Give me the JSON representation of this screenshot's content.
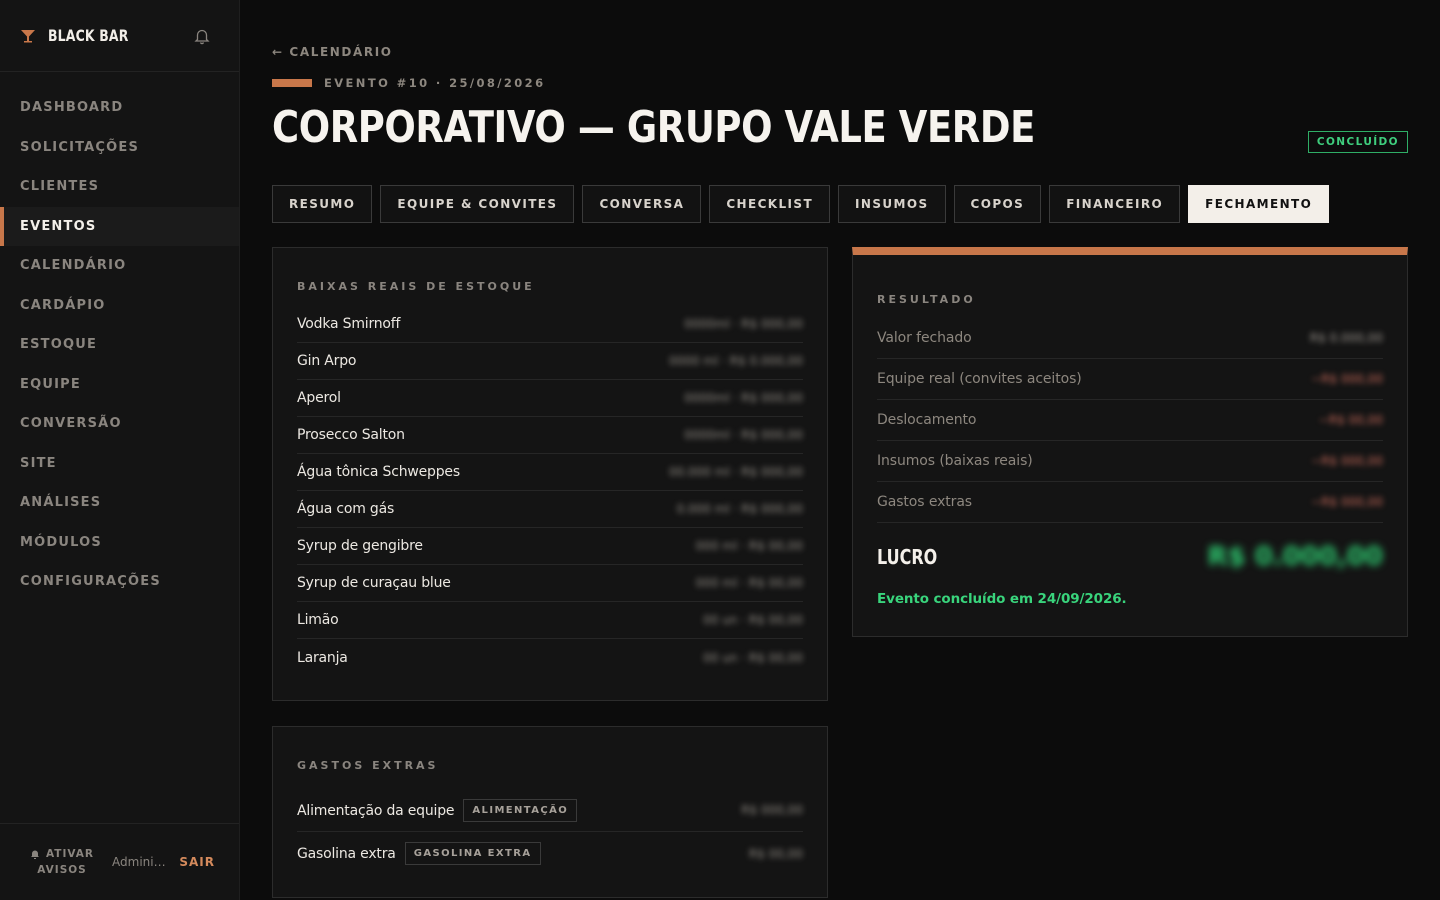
{
  "app": {
    "name": "BLACK BAR"
  },
  "sidebar": {
    "items": [
      {
        "label": "DASHBOARD",
        "active": false
      },
      {
        "label": "SOLICITAÇÕES",
        "active": false
      },
      {
        "label": "CLIENTES",
        "active": false
      },
      {
        "label": "EVENTOS",
        "active": true
      },
      {
        "label": "CALENDÁRIO",
        "active": false
      },
      {
        "label": "CARDÁPIO",
        "active": false
      },
      {
        "label": "ESTOQUE",
        "active": false
      },
      {
        "label": "EQUIPE",
        "active": false
      },
      {
        "label": "CONVERSÃO",
        "active": false
      },
      {
        "label": "SITE",
        "active": false
      },
      {
        "label": "ANÁLISES",
        "active": false
      },
      {
        "label": "MÓDULOS",
        "active": false
      },
      {
        "label": "CONFIGURAÇÕES",
        "active": false
      }
    ],
    "footer": {
      "notify_line1": "ATIVAR",
      "notify_line2": "AVISOS",
      "user": "Administ...",
      "logout": "SAIR"
    }
  },
  "header": {
    "back": "← CALENDÁRIO",
    "meta": "EVENTO #10 · 25/08/2026",
    "title": "CORPORATIVO — GRUPO VALE VERDE",
    "status": "CONCLUÍDO"
  },
  "tabs": [
    {
      "label": "RESUMO",
      "active": false
    },
    {
      "label": "EQUIPE & CONVITES",
      "active": false
    },
    {
      "label": "CONVERSA",
      "active": false
    },
    {
      "label": "CHECKLIST",
      "active": false
    },
    {
      "label": "INSUMOS",
      "active": false
    },
    {
      "label": "COPOS",
      "active": false
    },
    {
      "label": "FINANCEIRO",
      "active": false
    },
    {
      "label": "FECHAMENTO",
      "active": true
    }
  ],
  "stock": {
    "title": "BAIXAS REAIS DE ESTOQUE",
    "items": [
      {
        "name": "Vodka Smirnoff",
        "value": "0000ml · R$ 000,00"
      },
      {
        "name": "Gin Arpo",
        "value": "0000 ml · R$ 0.000,00"
      },
      {
        "name": "Aperol",
        "value": "0000ml · R$ 000,00"
      },
      {
        "name": "Prosecco Salton",
        "value": "0000ml · R$ 000,00"
      },
      {
        "name": "Água tônica Schweppes",
        "value": "00.000 ml · R$ 000,00"
      },
      {
        "name": "Água com gás",
        "value": "0.000 ml · R$ 000,00"
      },
      {
        "name": "Syrup de gengibre",
        "value": "000 ml · R$ 00,00"
      },
      {
        "name": "Syrup de curaçau blue",
        "value": "000 ml · R$ 00,00"
      },
      {
        "name": "Limão",
        "value": "00 un · R$ 00,00"
      },
      {
        "name": "Laranja",
        "value": "00 un · R$ 00,00"
      }
    ]
  },
  "extras": {
    "title": "GASTOS EXTRAS",
    "items": [
      {
        "name": "Alimentação da equipe",
        "tag": "ALIMENTAÇÃO",
        "value": "R$ 000,00"
      },
      {
        "name": "Gasolina extra",
        "tag": "GASOLINA EXTRA",
        "value": "R$ 00,00"
      }
    ]
  },
  "result": {
    "title": "RESULTADO",
    "rows": [
      {
        "label": "Valor fechado",
        "value": "R$ 0.000,00"
      },
      {
        "label": "Equipe real (convites aceitos)",
        "value": "−R$ 000,00"
      },
      {
        "label": "Deslocamento",
        "value": "−R$ 00,00"
      },
      {
        "label": "Insumos (baixas reais)",
        "value": "−R$ 000,00"
      },
      {
        "label": "Gastos extras",
        "value": "−R$ 000,00"
      }
    ],
    "profit_label": "LUCRO",
    "profit_value": "R$ 0.000,00",
    "note": "Evento concluído em 24/09/2026."
  },
  "colors": {
    "accent": "#c8774a",
    "success": "#3fcf7e",
    "negative": "#c86a5a"
  }
}
